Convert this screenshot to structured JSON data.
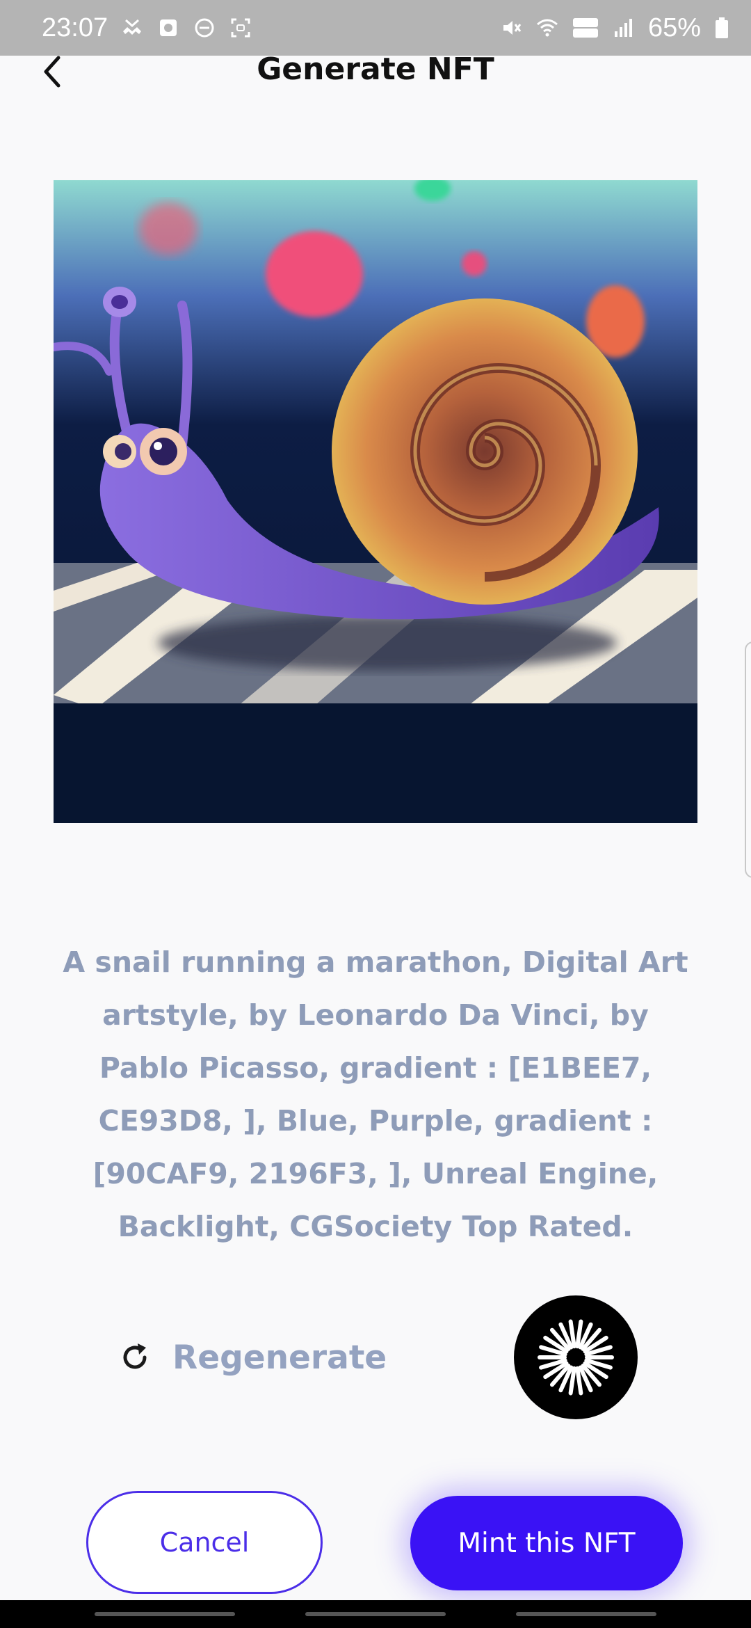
{
  "status_bar": {
    "time": "23:07",
    "battery": "65%",
    "icons_left": [
      "missed-call-icon",
      "square-app-icon",
      "dnd-icon",
      "screenshot-icon"
    ],
    "icons_right": [
      "mute-icon",
      "wifi-icon",
      "volte-icon",
      "signal-icon",
      "battery-icon"
    ]
  },
  "header": {
    "title": "Generate NFT",
    "back_icon": "chevron-left-icon"
  },
  "nft": {
    "image_icon": "snail-artwork",
    "prompt": "A snail running a marathon, Digital Art artstyle, by Leonardo Da Vinci, by Pablo Picasso, gradient : [E1BEE7, CE93D8, ], Blue, Purple, gradient : [90CAF9, 2196F3, ], Unreal Engine, Backlight, CGSociety Top Rated."
  },
  "actions": {
    "regenerate_label": "Regenerate",
    "regenerate_icon": "refresh-icon",
    "badge_icon": "sunburst-logo-icon",
    "cancel_label": "Cancel",
    "mint_label": "Mint this NFT"
  },
  "colors": {
    "accent": "#3a12f5",
    "cancel_border": "#4b2ee8",
    "prompt_text": "#8e9cb8",
    "status_bar_bg": "#b4b4b4"
  }
}
